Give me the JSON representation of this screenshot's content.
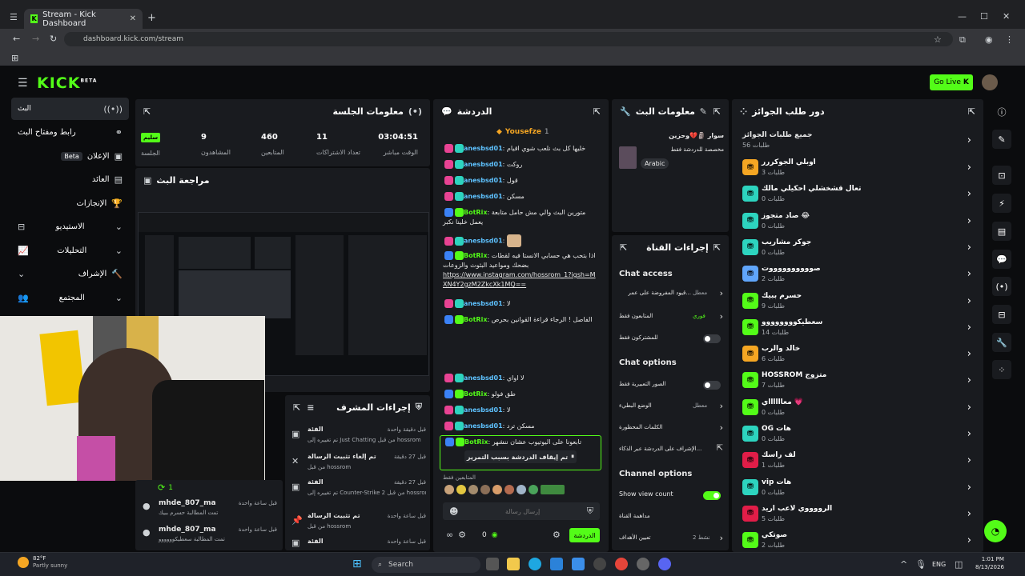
{
  "browser": {
    "tab_title": "Stream - Kick Dashboard",
    "url": "dashboard.kick.com/stream",
    "new_tab": "+"
  },
  "app": {
    "logo": "KICK",
    "logo_beta": "BETA",
    "go_live": "Go Live"
  },
  "sidebar": {
    "items": [
      {
        "label": "البث"
      },
      {
        "label": "رابط ومفتاح البث"
      },
      {
        "label": "الإعلان",
        "badge": "Beta"
      },
      {
        "label": "العائد"
      },
      {
        "label": "الإنجازات"
      },
      {
        "label": "الاستيديو"
      },
      {
        "label": "التحليلات"
      },
      {
        "label": "الإشراف"
      },
      {
        "label": "المجتمع"
      }
    ]
  },
  "session": {
    "title": "معلومات الجلسة",
    "stats": [
      {
        "value": "03:04:51",
        "label": "الوقت مباشر"
      },
      {
        "value": "11",
        "label": "تعداد الاشتراكات"
      },
      {
        "value": "460",
        "label": "المتابعين"
      },
      {
        "value": "9",
        "label": "المشاهدون"
      },
      {
        "value": "سليم",
        "label": "الجلسة"
      }
    ]
  },
  "preview": {
    "title": "مراجعة البث"
  },
  "mod_actions": {
    "title": "إجراءات المشرف",
    "rows": [
      {
        "title": "الفئة",
        "time": "قبل دقيقة واحدة",
        "desc": "تم تغييره إلى Just Chatting من قبل hossrom"
      },
      {
        "title": "تم إلغاء تثبيت الرسالة",
        "time": "قبل 27 دقيقة",
        "desc": "من قبل hossrom"
      },
      {
        "title": "الفئة",
        "time": "قبل 27 دقيقة",
        "desc": "تم تغييره إلى Counter-Strike 2 من قبل hossrom"
      },
      {
        "title": "تم تثبيت الرسالة",
        "time": "قبل ساعة واحدة",
        "desc": "من قبل hossrom"
      },
      {
        "title": "الفئة",
        "time": "قبل ساعة واحدة",
        "desc": ""
      }
    ]
  },
  "activity": {
    "count": "1",
    "rows": [
      {
        "name": "mhde_807_ma",
        "time": "قبل ساعة واحدة",
        "desc": "تمت المطالبة حسرم ببيك"
      },
      {
        "name": "mhde_807_ma",
        "time": "قبل ساعة واحدة",
        "desc": "تمت المطالبة سعطيكوووووو"
      }
    ]
  },
  "chat": {
    "title": "الدردشة",
    "pinned_user": "Yousefze",
    "pinned_count": "1",
    "messages": [
      {
        "user": "anesbsd01",
        "text": "خليها كل بث نلعب شوي اقيام"
      },
      {
        "user": "anesbsd01",
        "text": "روكت"
      },
      {
        "user": "anesbsd01",
        "text": "قول"
      },
      {
        "user": "anesbsd01",
        "text": "مسكن"
      },
      {
        "user": "BotRix",
        "text": "متورين البث والي مش حامل متابعة يعمل خلينا نكبر"
      },
      {
        "user": "anesbsd01",
        "text": ""
      },
      {
        "user": "BotRix",
        "text": "اذا بتحب هي حسابي الانستا فيه لقطات بضحك ومواعيد البثوث والزوعات"
      },
      {
        "user": "anesbsd01",
        "text": "لا"
      },
      {
        "user": "BotRix",
        "text": "الفاصل ! الرجاء قراءة القوانين بحرص"
      },
      {
        "user": "anesbsd01",
        "text": "لا اواي"
      },
      {
        "user": "BotRix",
        "text": "طق فولو"
      },
      {
        "user": "anesbsd01",
        "text": "لا"
      },
      {
        "user": "anesbsd01",
        "text": "مسكن ترد"
      },
      {
        "user": "BotRix",
        "text": "تابعونا على اليوتيوب عشان ننشهر"
      }
    ],
    "link": "https://www.instagram.com/hossrom_1?igsh=MXN4Y2gzM2ZkcXk1MQ==",
    "paused": "تم إيقاف الدردشة بسبب التمرير",
    "followers_only": "المتابعين فقط",
    "input_placeholder": "إرسال رسالة",
    "send_label": "الدردشة",
    "points": "0"
  },
  "stream_info": {
    "title": "معلومات البث",
    "stream_title": "سوار 🗿💔وحزين",
    "category": "مخصصة للدردشة فقط",
    "language": "Arabic"
  },
  "channel_actions": {
    "title": "إجراءات القناة",
    "chat_access": "Chat access",
    "rows_access": [
      {
        "label": "قيود المفروضة على عمر...",
        "value": "معطل"
      },
      {
        "label": "المتابعون فقط",
        "value": "فوري"
      },
      {
        "label": "للمشتركون فقط",
        "value": ""
      }
    ],
    "chat_options": "Chat options",
    "rows_options": [
      {
        "label": "الصور التعبيرية فقط",
        "value": ""
      },
      {
        "label": "الوضع البطيء",
        "value": "معطل"
      },
      {
        "label": "الكلمات المحظورة",
        "value": ""
      },
      {
        "label": "الإشراف على الدردشة عبر الذكاء...",
        "value": ""
      }
    ],
    "channel_options": "Channel options",
    "show_view_count": "Show view count",
    "rows_channel": [
      {
        "label": "مداهمة القناة",
        "value": ""
      },
      {
        "label": "تعيين الأهداف",
        "value": "نشط 2"
      }
    ]
  },
  "queue": {
    "title": "دور طلب الجوائز",
    "all_label": "جميع طلبات الجوائز",
    "all_count": "56 طلبات",
    "items": [
      {
        "name": "اوبلي الجوكررر",
        "count": "3 طلبات",
        "color": "#f5a623"
      },
      {
        "name": "تعال قشخشلي احكيلي مالك",
        "count": "0 طلبات",
        "color": "#2dd4bf"
      },
      {
        "name": "صاد متجوز 😂",
        "count": "0 طلبات",
        "color": "#2dd4bf"
      },
      {
        "name": "جوكر مشاريب",
        "count": "0 طلبات",
        "color": "#2dd4bf"
      },
      {
        "name": "صووووووووووت",
        "count": "2 طلبات",
        "color": "#60a5fa"
      },
      {
        "name": "حسرم ببيك",
        "count": "9 طلبات",
        "color": "#53fc18"
      },
      {
        "name": "سعطيكوووووووو",
        "count": "14 طلبات",
        "color": "#53fc18"
      },
      {
        "name": "خالد والرب",
        "count": "6 طلبات",
        "color": "#f5a623"
      },
      {
        "name": "HOSSROM متزوج",
        "count": "7 طلبات",
        "color": "#53fc18"
      },
      {
        "name": "معااااااي 💗",
        "count": "0 طلبات",
        "color": "#53fc18"
      },
      {
        "name": "OG هات",
        "count": "0 طلبات",
        "color": "#2dd4bf"
      },
      {
        "name": "لف راسك",
        "count": "1 طلبات",
        "color": "#e11d48"
      },
      {
        "name": "vip هات",
        "count": "0 طلبات",
        "color": "#2dd4bf"
      },
      {
        "name": "الرووووي لاعب اريد",
        "count": "5 طلبات",
        "color": "#e11d48"
      },
      {
        "name": "صوتكي",
        "count": "2 طلبات",
        "color": "#53fc18"
      }
    ]
  },
  "taskbar": {
    "weather_temp": "82°F",
    "weather_desc": "Partly sunny",
    "search": "Search",
    "lang": "ENG",
    "time": "1:01 PM",
    "date": "8/13/2026"
  }
}
